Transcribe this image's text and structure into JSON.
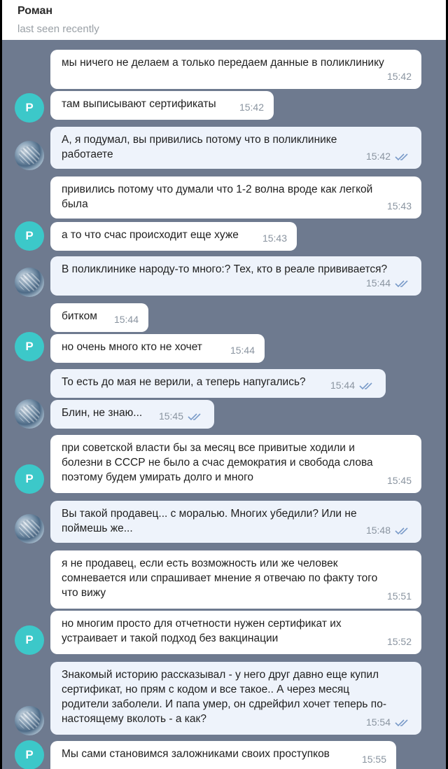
{
  "header": {
    "name": "Роман",
    "status": "last seen recently"
  },
  "messages": [
    {
      "text": "мы ничего не делаем а только передаем данные в поликлинику",
      "time": "15:42"
    },
    {
      "text": "там выписывают сертификаты",
      "time": "15:42"
    },
    {
      "text": "А, я подумал, вы привились потому что в поликлинике\nработаете",
      "time": "15:42",
      "read": true
    },
    {
      "text": "привились потому что думали что 1-2 волна вроде как легкой\nбыла",
      "time": "15:43"
    },
    {
      "text": "а то что счас происходит еще хуже",
      "time": "15:43"
    },
    {
      "text": "В поликлинике народу-то много:? Тех, кто в реале прививается?",
      "time": "15:44",
      "read": true
    },
    {
      "text": "битком",
      "time": "15:44"
    },
    {
      "text": "но очень много кто не хочет",
      "time": "15:44"
    },
    {
      "text": "То есть до мая не верили, а теперь напугались?",
      "time": "15:44",
      "read": true
    },
    {
      "text": "Блин, не знаю...",
      "time": "15:45",
      "read": true
    },
    {
      "text": "при советской власти бы за месяц все привитые ходили и\nболезни в СССР не было а счас демократия и свобода слова\nпоэтому будем умирать долго и много",
      "time": "15:45"
    },
    {
      "text": "Вы такой продавец... с моралью. Многих убедили? Или не\nпоймешь же...",
      "time": "15:48",
      "read": true
    },
    {
      "text": "я не продавец, если есть возможность или же человек\nсомневается или спрашивает мнение я отвечаю по факту того\nчто вижу",
      "time": "15:51"
    },
    {
      "text": "но многим просто для отчетности нужен сертификат их\nустраивает и такой подход без вакцинации",
      "time": "15:52"
    },
    {
      "text": "Знакомый историю рассказывал - у него друг давно еще купил\nсертификат, но прям с кодом и все такое.. А через месяц\nродители заболели. И папа умер, он сдрейфил хочет теперь по-\nнастоящему вколоть - а как?",
      "time": "15:54",
      "read": true
    },
    {
      "text": "Мы сами становимся заложниками своих проступков",
      "time": "15:55"
    }
  ],
  "avatar_letter": "Р",
  "colors": {
    "background": "#6e7a8f",
    "avatar": "#3cc8c9",
    "check": "#7a9bc9"
  }
}
